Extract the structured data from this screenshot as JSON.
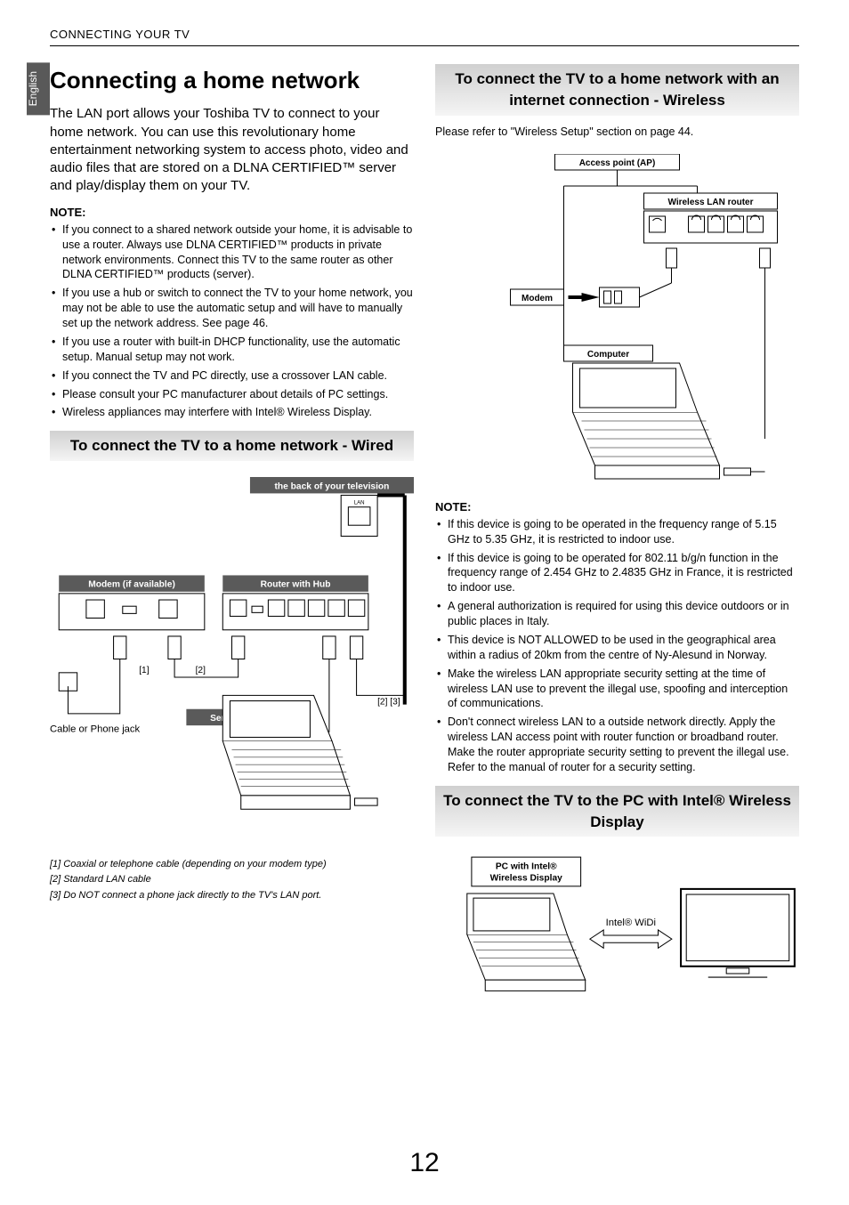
{
  "header": {
    "section": "CONNECTING YOUR TV"
  },
  "lang_tab": "English",
  "title": "Connecting a home network",
  "intro": "The LAN port allows your Toshiba TV to connect to your home network. You can use this revolutionary home entertainment networking system to access photo, video and audio files that are stored on a DLNA CERTIFIED™ server and play/display them on your TV.",
  "note_label": "NOTE:",
  "notes1": [
    "If you connect to a shared network outside your home, it is advisable to use a router. Always use DLNA CERTIFIED™ products in private network environments. Connect this TV to the same router as other DLNA CERTIFIED™ products (server).",
    "If you use a hub or switch to connect the TV to your home network, you may not be able to use the automatic setup and will have to manually set up the network address. See page 46.",
    "If you use a router with built-in DHCP functionality, use the automatic setup. Manual setup may not work.",
    "If you connect the TV and PC directly, use a crossover LAN cable.",
    "Please consult your PC manufacturer about details of PC settings.",
    "Wireless appliances may interfere with Intel® Wireless Display."
  ],
  "section_wired": "To connect the TV to a home network - Wired",
  "wired_diagram": {
    "tv_back": "the back of your television",
    "lan_label": "LAN",
    "modem": "Modem (if available)",
    "router": "Router with Hub",
    "server": "Server PC",
    "cable_jack": "Cable or Phone jack",
    "ref1": "[1]",
    "ref2": "[2]",
    "ref23": "[2] [3]"
  },
  "footnotes": [
    "[1] Coaxial or telephone cable (depending on your modem type)",
    "[2] Standard LAN cable",
    "[3] Do NOT connect a phone jack directly to the TV's LAN port."
  ],
  "section_wireless": "To connect the TV to a home network with an internet connection - Wireless",
  "wireless_intro": "Please refer to \"Wireless Setup\" section on page 44.",
  "wireless_diagram": {
    "ap": "Access point (AP)",
    "router": "Wireless LAN router",
    "modem": "Modem",
    "computer": "Computer"
  },
  "notes2": [
    "If this device is going to be operated in the frequency range of 5.15 GHz to 5.35 GHz, it is restricted to indoor use.",
    "If this device is going to be operated for 802.11 b/g/n function in the frequency range of 2.454 GHz to 2.4835 GHz in France, it is restricted to indoor use.",
    "A general authorization is required for using this device outdoors or in public places in Italy.",
    "This device is NOT ALLOWED to be used in the geographical area within a radius of 20km from the centre of Ny-Alesund in Norway.",
    "Make the wireless LAN appropriate security setting at the time of  wireless LAN use to prevent the illegal use, spoofing and interception of communications.",
    "Don't connect wireless LAN to a outside network directly. Apply the wireless LAN access point with router function or broadband router. Make the router appropriate security setting to prevent  the illegal use.\nRefer to the manual of router for a security setting."
  ],
  "section_widi": "To connect the TV to the PC with Intel® Wireless Display",
  "widi_diagram": {
    "pc": "PC with Intel®\nWireless Display",
    "link": "Intel® WiDi"
  },
  "page_number": "12"
}
